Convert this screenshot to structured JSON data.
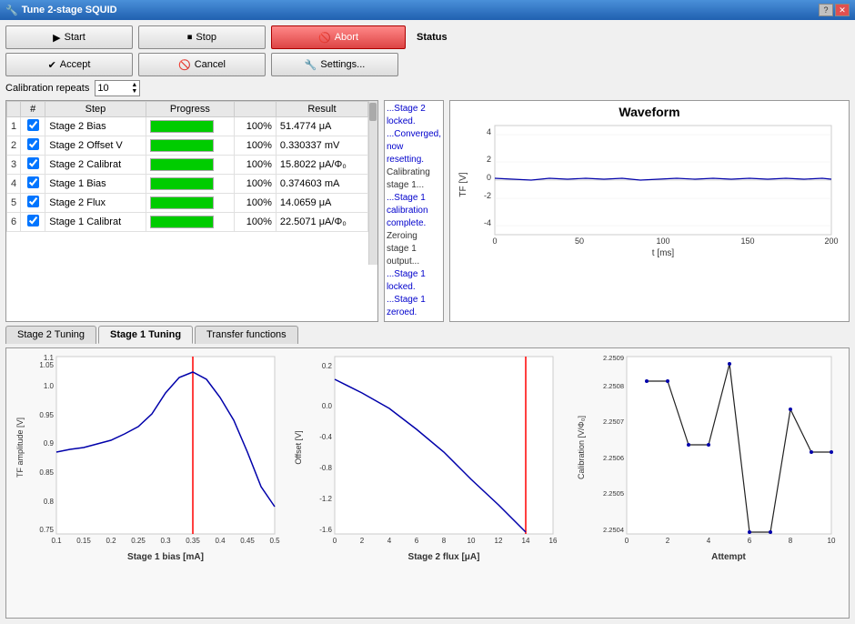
{
  "window": {
    "title": "Tune 2-stage SQUID",
    "icon": "⚙"
  },
  "titlebar": {
    "help_label": "?",
    "close_label": "✕"
  },
  "buttons": {
    "start_label": "Start",
    "stop_label": "Stop",
    "abort_label": "Abort",
    "accept_label": "Accept",
    "cancel_label": "Cancel",
    "settings_label": "Settings..."
  },
  "calibration": {
    "label": "Calibration repeats",
    "value": "10"
  },
  "table": {
    "headers": [
      "",
      "#",
      "Step",
      "Progress",
      "",
      "Result"
    ],
    "rows": [
      {
        "num": "1",
        "checked": true,
        "name": "Stage 2 Bias",
        "pct": "100%",
        "result": "51.4774 μA"
      },
      {
        "num": "2",
        "checked": true,
        "name": "Stage 2 Offset V",
        "pct": "100%",
        "result": "0.330337 mV"
      },
      {
        "num": "3",
        "checked": true,
        "name": "Stage 2 Calibrat",
        "pct": "100%",
        "result": "15.8022 μA/Φ₀"
      },
      {
        "num": "4",
        "checked": true,
        "name": "Stage 1 Bias",
        "pct": "100%",
        "result": "0.374603 mA"
      },
      {
        "num": "5",
        "checked": true,
        "name": "Stage 2 Flux",
        "pct": "100%",
        "result": "14.0659 μA"
      },
      {
        "num": "6",
        "checked": true,
        "name": "Stage 1 Calibrat",
        "pct": "100%",
        "result": "22.5071 μA/Φ₀"
      }
    ]
  },
  "status": {
    "label": "Status",
    "lines": [
      {
        "text": "...Stage 2 locked.",
        "blue": true
      },
      {
        "text": "...Converged, now resetting.",
        "blue": true
      },
      {
        "text": "Calibrating stage 1...",
        "blue": false
      },
      {
        "text": "...Stage 1 calibration complete.",
        "blue": true
      },
      {
        "text": "Zeroing stage 1 output...",
        "blue": false
      },
      {
        "text": "...Stage 1 locked.",
        "blue": true
      },
      {
        "text": "...Stage 1 zeroed.",
        "blue": true
      }
    ]
  },
  "waveform": {
    "title": "Waveform",
    "y_label": "TF [V]",
    "x_label": "t [ms]",
    "y_min": -4,
    "y_max": 4,
    "x_min": 0,
    "x_max": 200
  },
  "tabs": [
    {
      "label": "Stage 2 Tuning",
      "active": false
    },
    {
      "label": "Stage 1 Tuning",
      "active": true
    },
    {
      "label": "Transfer functions",
      "active": false
    }
  ],
  "charts": {
    "chart1": {
      "title": "Stage 1 bias [mA]",
      "y_label": "TF amplitude [V]",
      "y_min": 0.75,
      "y_max": 1.1,
      "x_min": 0.1,
      "x_max": 0.5,
      "x_ticks": [
        "0.1",
        "0.15",
        "0.2",
        "0.25",
        "0.3",
        "0.35",
        "0.4",
        "0.45",
        "0.5"
      ],
      "red_line_x": 0.35
    },
    "chart2": {
      "title": "Stage 2 flux [μA]",
      "y_label": "Offset [V]",
      "y_min": -1.6,
      "y_max": 0.2,
      "x_min": 0,
      "x_max": 16,
      "x_ticks": [
        "0",
        "2",
        "4",
        "6",
        "8",
        "10",
        "12",
        "14",
        "16"
      ],
      "red_line_x": 14
    },
    "chart3": {
      "title": "Attempt",
      "y_label": "Calibration [V/Φ₀]",
      "y_min": 2.2504,
      "y_max": 2.2509,
      "x_min": 0,
      "x_max": 10,
      "x_ticks": [
        "0",
        "2",
        "4",
        "6",
        "8",
        "10"
      ],
      "points": [
        {
          "x": 1,
          "y": 2.25083
        },
        {
          "x": 2,
          "y": 2.25083
        },
        {
          "x": 3,
          "y": 2.25065
        },
        {
          "x": 4,
          "y": 2.25065
        },
        {
          "x": 5,
          "y": 2.25088
        },
        {
          "x": 6,
          "y": 2.2504
        },
        {
          "x": 7,
          "y": 2.2504
        },
        {
          "x": 8,
          "y": 2.25075
        },
        {
          "x": 9,
          "y": 2.25063
        },
        {
          "x": 10,
          "y": 2.25063
        }
      ]
    }
  },
  "colors": {
    "accent_blue": "#0000cc",
    "progress_green": "#00cc00",
    "red_line": "#cc0000",
    "chart_line": "#0000aa"
  }
}
